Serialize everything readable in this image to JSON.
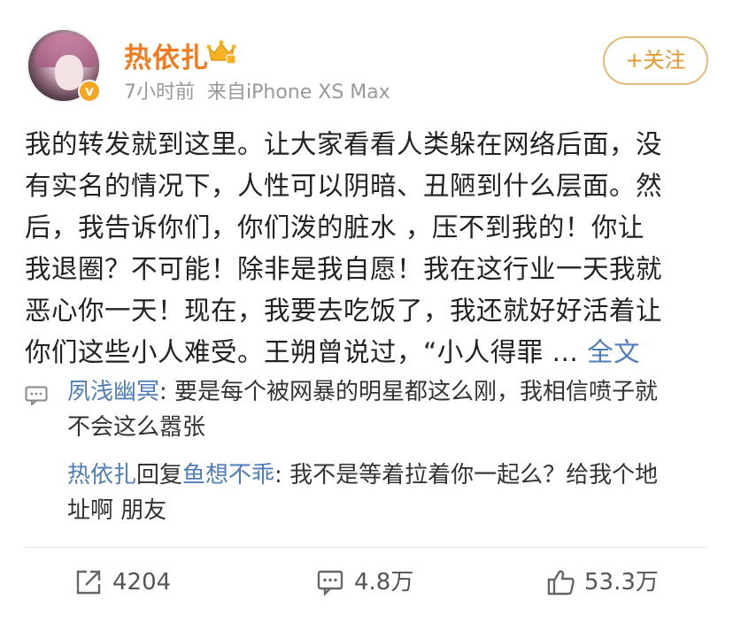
{
  "header": {
    "username": "热依扎",
    "time": "7小时前",
    "source": "来自iPhone XS Max",
    "follow_label": "+关注",
    "badge_letter": "v"
  },
  "post": {
    "lines": [
      "我的转发就到这里。让大家看看人类躲在网络后面，没",
      "有实名的情况下，人性可以阴暗、丑陋到什么层面。然",
      "后，我告诉你们，你们泼的脏水 ，压不到我的！你让",
      "我退圈？不可能！除非是我自愿！我在这行业一天我就",
      "恶心你一天！现在，我要去吃饭了，我还就好好活着让",
      "你们这些小人难受。王朔曾说过，“小人得罪 ..."
    ],
    "fulltext_label": " 全文"
  },
  "comments": [
    {
      "name": "夙浅幽冥",
      "separator": ": ",
      "text_line1": "要是每个被网暴的明星都这么刚，我相信喷子就",
      "text_line2": "不会这么嚣张"
    },
    {
      "name": "热依扎",
      "reply_word": "回复",
      "reply_to": "鱼想不乖",
      "separator": ": ",
      "text_line1": "我不是等着拉着你一起么？给我个地",
      "text_line2": "址啊 朋友"
    }
  ],
  "footer": {
    "reposts": "4204",
    "comments": "4.8万",
    "likes": "53.3万"
  },
  "colors": {
    "username": "#f07c1f",
    "link": "#4f7db8",
    "follow_border": "#e4b97a",
    "follow_text": "#e8952c",
    "meta": "#999999"
  },
  "icons": {
    "crown": "crown-icon",
    "comment_marker": "comment-bubble-icon",
    "repost": "repost-icon",
    "comment": "comment-icon",
    "like": "thumbs-up-icon"
  }
}
